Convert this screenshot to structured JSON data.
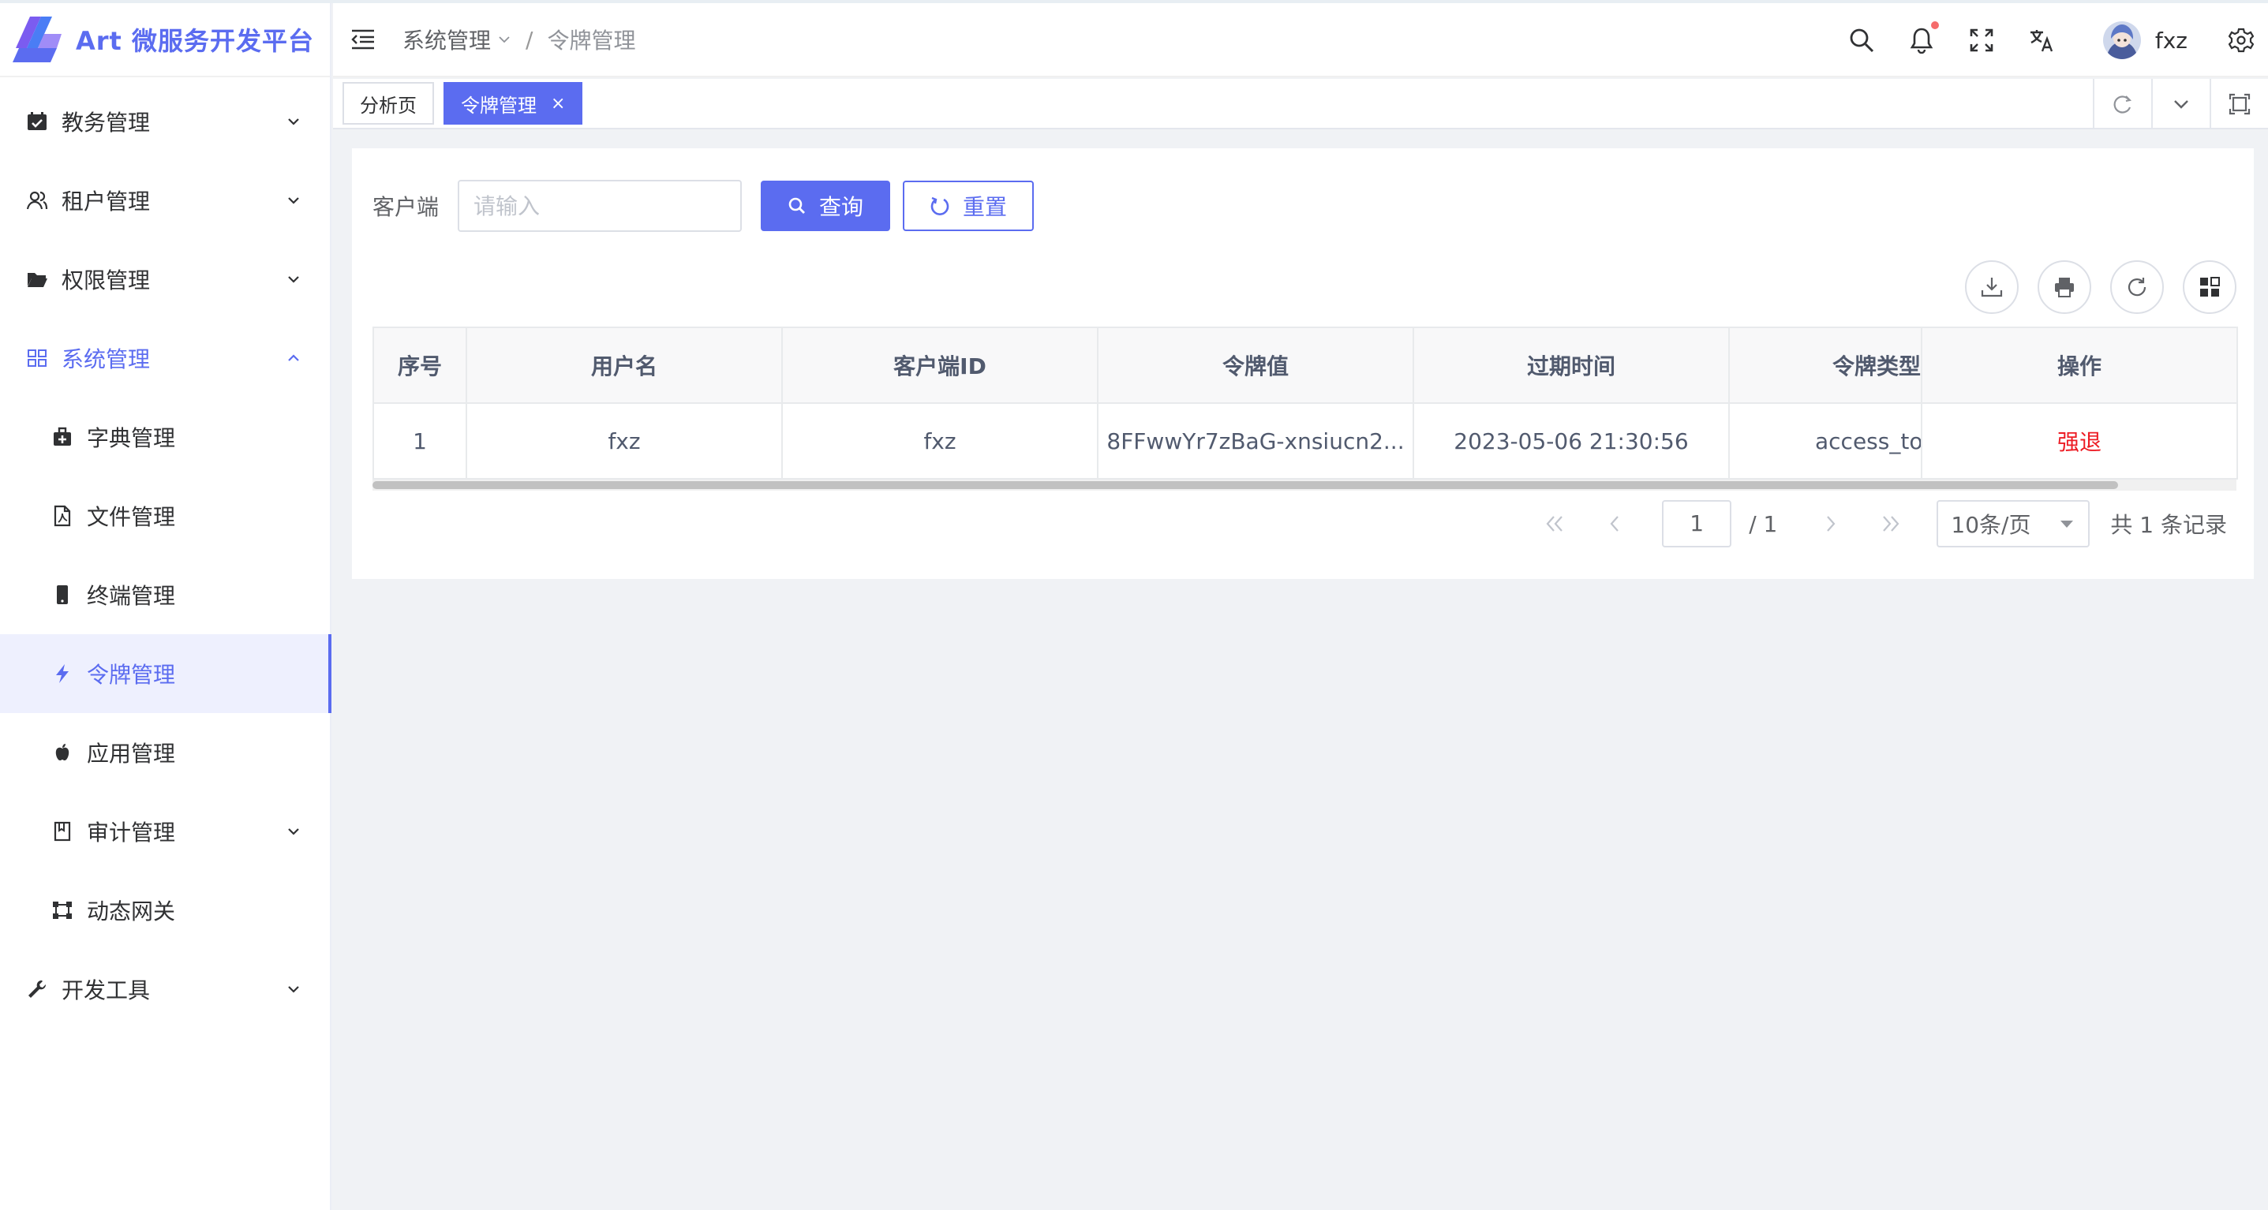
{
  "app": {
    "title": "Art 微服务开发平台"
  },
  "sidebar": {
    "items": [
      {
        "label": "教务管理",
        "icon": "calendar-check-icon",
        "expandable": true
      },
      {
        "label": "租户管理",
        "icon": "user-group-icon",
        "expandable": true
      },
      {
        "label": "权限管理",
        "icon": "folder-open-icon",
        "expandable": true
      },
      {
        "label": "系统管理",
        "icon": "grid-icon",
        "expandable": true,
        "open": true
      },
      {
        "label": "字典管理",
        "icon": "medkit-icon"
      },
      {
        "label": "文件管理",
        "icon": "file-pdf-icon"
      },
      {
        "label": "终端管理",
        "icon": "mobile-icon"
      },
      {
        "label": "令牌管理",
        "icon": "bolt-icon",
        "active": true
      },
      {
        "label": "应用管理",
        "icon": "apple-icon"
      },
      {
        "label": "审计管理",
        "icon": "book-icon",
        "expandable": true
      },
      {
        "label": "动态网关",
        "icon": "vector-square-icon"
      },
      {
        "label": "开发工具",
        "icon": "wrench-icon",
        "expandable": true
      }
    ]
  },
  "header": {
    "breadcrumb": {
      "parent": "系统管理",
      "separator": "/",
      "current": "令牌管理"
    },
    "username": "fxz"
  },
  "tabs": [
    {
      "label": "分析页",
      "active": false
    },
    {
      "label": "令牌管理",
      "active": true,
      "close": "×"
    }
  ],
  "search": {
    "label": "客户端",
    "placeholder": "请输入",
    "query_label": "查询",
    "reset_label": "重置"
  },
  "table": {
    "columns": [
      "序号",
      "用户名",
      "客户端ID",
      "令牌值",
      "过期时间",
      "令牌类型",
      "操作"
    ],
    "rows": [
      {
        "index": "1",
        "username": "fxz",
        "client_id": "fxz",
        "token": "8FFwwYr7zBaG-xnsiucn2...",
        "expires": "2023-05-06 21:30:56",
        "token_type": "access_token",
        "action": "强退"
      }
    ]
  },
  "pagination": {
    "current_page": "1",
    "total_pages": "/ 1",
    "page_size": "10条/页",
    "total": "共 1 条记录"
  },
  "colors": {
    "primary": "#5b6cf0",
    "danger": "#ed1c24",
    "notify_dot": "#f56c6c"
  }
}
